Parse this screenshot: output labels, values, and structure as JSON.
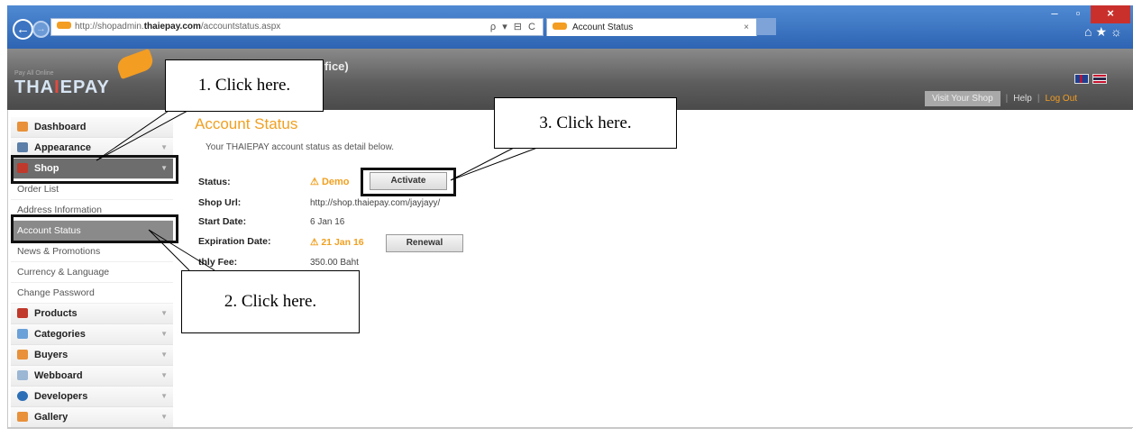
{
  "browser": {
    "url_prefix": "http://shopadmin.",
    "url_domain": "thaiepay.com",
    "url_path": "/accountstatus.aspx",
    "url_tools": "ρ ▾ ⊟ C",
    "tab_title": "Account Status",
    "tab_close": "×",
    "back_glyph": "←",
    "forward_glyph": "→",
    "win_minimize": "–",
    "win_maximize": "▫",
    "win_close": "×",
    "tools_glyphs": "⌂★☼"
  },
  "header": {
    "logo_text_a": "THA",
    "logo_text_i": "I",
    "logo_text_b": "EPAY",
    "logo_small": "Pay All Online",
    "title_fragment": "fice)",
    "visit_shop": "Visit Your Shop",
    "help": "Help",
    "logout": "Log Out",
    "sep": "|"
  },
  "sidebar": {
    "items": [
      {
        "label": "Dashboard",
        "icon": "house-icon",
        "color": "#e8913a"
      },
      {
        "label": "Appearance",
        "icon": "monitor-icon",
        "color": "#5b7fa8"
      },
      {
        "label": "Shop",
        "icon": "shop-icon",
        "color": "#c0392b"
      }
    ],
    "sub_items": [
      "Order List",
      "Address Information",
      "Account Status",
      "News & Promotions",
      "Currency & Language",
      "Change Password"
    ],
    "items_after": [
      {
        "label": "Products",
        "icon": "products-icon",
        "color": "#c0392b"
      },
      {
        "label": "Categories",
        "icon": "categories-icon",
        "color": "#6aa1d8"
      },
      {
        "label": "Buyers",
        "icon": "buyers-icon",
        "color": "#e8913a"
      },
      {
        "label": "Webboard",
        "icon": "webboard-icon",
        "color": "#9bb7d4"
      },
      {
        "label": "Developers",
        "icon": "developers-icon",
        "color": "#2c6fb7"
      },
      {
        "label": "Gallery",
        "icon": "gallery-icon",
        "color": "#e8913a"
      }
    ],
    "chevron": "▼"
  },
  "content": {
    "title": "Account Status",
    "subtitle": "Your THAIEPAY account status as detail below.",
    "status_label": "Status:",
    "status_value": "Demo",
    "warn_glyph": "⚠",
    "activate_button": "Activate",
    "shop_url_label": "Shop Url:",
    "shop_url_value": "http://shop.thaiepay.com/jayjayy/",
    "start_date_label": "Start Date:",
    "start_date_value": "6 Jan 16",
    "expiration_label": "Expiration Date:",
    "expiration_value": "21 Jan 16",
    "renewal_button": "Renewal",
    "fee_label": "thly Fee:",
    "fee_value": "350.00 Baht"
  },
  "callouts": {
    "step1": "1. Click here.",
    "step2": "2. Click here.",
    "step3": "3. Click here."
  }
}
